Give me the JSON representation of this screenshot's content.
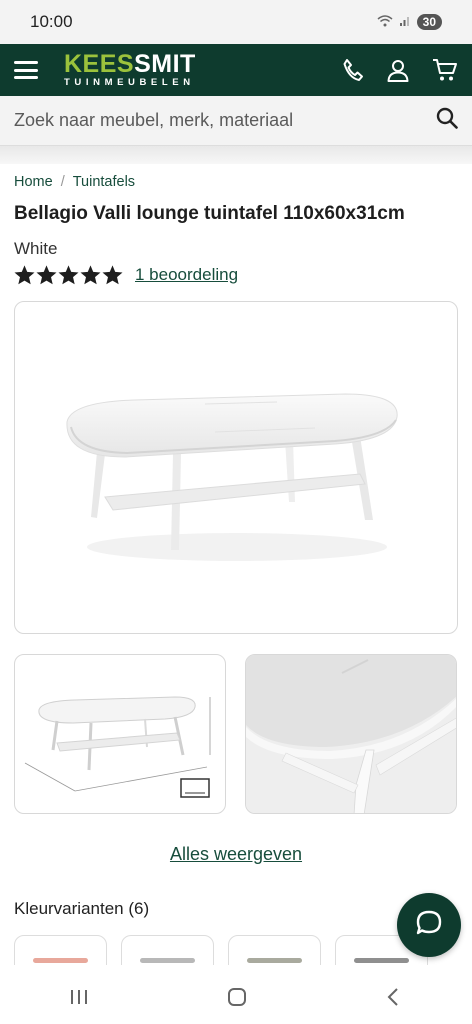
{
  "status_bar": {
    "time": "10:00",
    "battery": "30"
  },
  "header": {
    "logo_part1": "KEES",
    "logo_part2": "SMIT",
    "logo_sub": "TUINMEUBELEN",
    "icons": [
      "menu-icon",
      "phone-icon",
      "account-icon",
      "cart-icon"
    ]
  },
  "search": {
    "placeholder": "Zoek naar meubel, merk, materiaal"
  },
  "breadcrumb": {
    "home": "Home",
    "category": "Tuintafels"
  },
  "product": {
    "title": "Bellagio Valli lounge tuintafel 110x60x31cm",
    "variant": "White",
    "rating": 5,
    "reviews_link": "1 beoordeling"
  },
  "gallery": {
    "show_all": "Alles weergeven"
  },
  "variants": {
    "title": "Kleurvarianten (6)"
  },
  "colors": {
    "brand_dark": "#0e3b2e",
    "brand_green": "#9bc23c",
    "link": "#174d3c"
  }
}
